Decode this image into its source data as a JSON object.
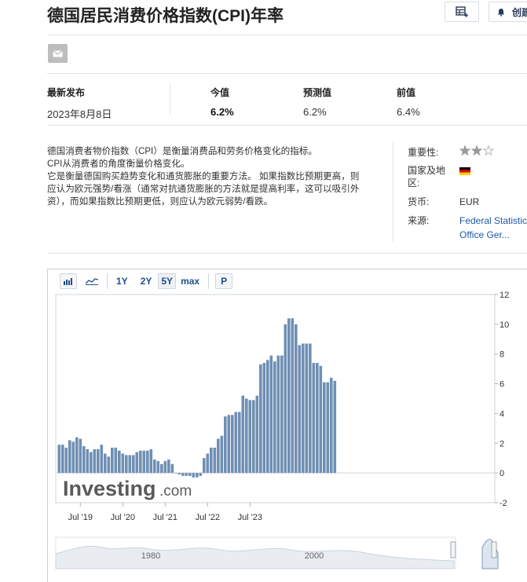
{
  "header": {
    "title": "德国居民消费价格指数(CPI)年率",
    "alert_label": "创建"
  },
  "stats": {
    "latest_release": {
      "label": "最新发布",
      "value": "2023年8月8日"
    },
    "actual": {
      "label": "今值",
      "value": "6.2%"
    },
    "forecast": {
      "label": "预测值",
      "value": "6.2%"
    },
    "previous": {
      "label": "前值",
      "value": "6.4%"
    }
  },
  "description": [
    "德国消费者物价指数（CPI）是衡量消费品和劳务价格变化的指标。",
    "CPI从消费者的角度衡量价格变化。",
    "它是衡量德国购买趋势变化和通货膨胀的重要方法。 如果指数比预期更高，则应认为欧元强势/看涨（通常对抗通货膨胀的方法就是提高利率，这可以吸引外资），而如果指数比预期更低，则应认为欧元弱势/看跌。"
  ],
  "meta": {
    "importance_label": "重要性:",
    "importance_stars": 2,
    "importance_max": 3,
    "country_label": "国家及地区:",
    "currency_label": "货币:",
    "currency_value": "EUR",
    "source_label": "来源:",
    "source_value_line1": "Federal Statistic",
    "source_value_line2": "Office Ger..."
  },
  "toolbar": {
    "ranges": [
      "1Y",
      "2Y",
      "5Y",
      "max"
    ],
    "selected_range": "5Y",
    "p_label": "P"
  },
  "watermark": {
    "brand": "Investing",
    "suffix": ".com"
  },
  "navigator": {
    "labels": [
      "1980",
      "2000"
    ]
  },
  "colors": {
    "bar": "#6f8fb3",
    "link": "#1f5aa6",
    "accent": "#1f4e8c"
  },
  "chart_data": {
    "type": "bar",
    "title": "",
    "xlabel": "",
    "ylabel": "",
    "ylim": [
      -2,
      12
    ],
    "yticks": [
      -2,
      0,
      2,
      4,
      6,
      8,
      10,
      12
    ],
    "xticks": [
      {
        "label": "Jul '19",
        "index": 6
      },
      {
        "label": "Jul '20",
        "index": 18
      },
      {
        "label": "Jul '21",
        "index": 30
      },
      {
        "label": "Jul '22",
        "index": 42
      },
      {
        "label": "Jul '23",
        "index": 54
      }
    ],
    "start": "2019-01",
    "values": [
      1.9,
      1.9,
      1.7,
      2.2,
      2.1,
      2.4,
      2.3,
      1.8,
      1.6,
      1.4,
      1.6,
      1.6,
      1.9,
      1.3,
      1.1,
      1.7,
      1.7,
      1.5,
      1.3,
      1.2,
      1.2,
      1.2,
      1.4,
      1.5,
      1.5,
      1.5,
      1.6,
      0.9,
      0.8,
      0.6,
      0.8,
      0.9,
      0.6,
      0.0,
      -0.1,
      -0.2,
      -0.2,
      -0.2,
      -0.3,
      -0.3,
      -0.2,
      1.0,
      1.3,
      1.7,
      1.7,
      2.3,
      2.5,
      3.8,
      3.9,
      3.9,
      4.1,
      4.1,
      5.2,
      5.0,
      4.9,
      4.9,
      5.2,
      7.3,
      7.4,
      7.6,
      7.9,
      7.5,
      7.9,
      7.9,
      10.0,
      10.4,
      10.4,
      10.0,
      8.6,
      8.7,
      8.7,
      8.7,
      7.4,
      7.4,
      7.2,
      6.1,
      6.1,
      6.4,
      6.2
    ]
  }
}
